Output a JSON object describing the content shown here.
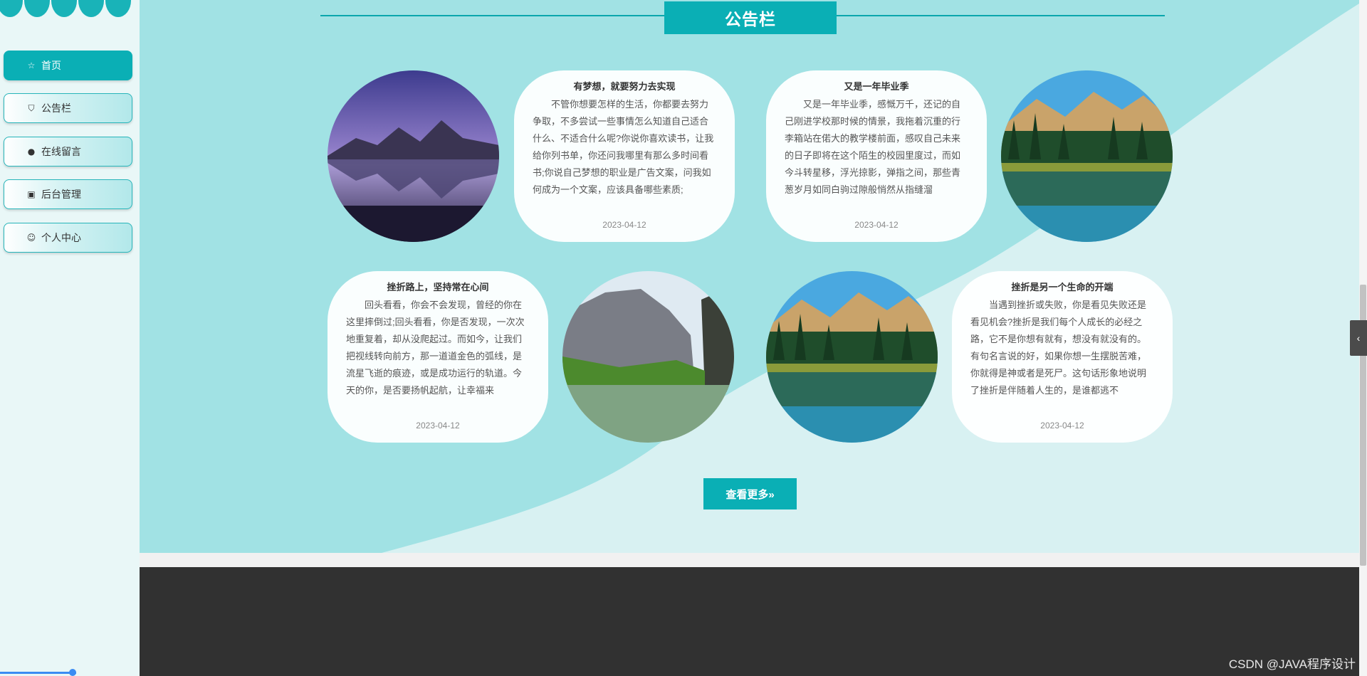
{
  "sidebar": {
    "items": [
      {
        "label": "首页",
        "icon": "star-icon",
        "glyph": "☆"
      },
      {
        "label": "公告栏",
        "icon": "bag-icon",
        "glyph": "⛉"
      },
      {
        "label": "在线留言",
        "icon": "alert-icon",
        "glyph": "●"
      },
      {
        "label": "后台管理",
        "icon": "briefcase-icon",
        "glyph": "▣"
      },
      {
        "label": "个人中心",
        "icon": "user-icon",
        "glyph": "☺"
      }
    ]
  },
  "section": {
    "title": "公告栏"
  },
  "cards": [
    {
      "title": "有梦想，就要努力去实现",
      "body": "不管你想要怎样的生活，你都要去努力争取，不多尝试一些事情怎么知道自己适合什么、不适合什么呢?你说你喜欢读书，让我给你列书单，你还问我哪里有那么多时间看书;你说自己梦想的职业是广告文案，问我如何成为一个文案，应该具备哪些素质;",
      "date": "2023-04-12"
    },
    {
      "title": "又是一年毕业季",
      "body": "又是一年毕业季，感慨万千，还记的自己刚进学校那时候的情景，我拖着沉重的行李箱站在偌大的教学楼前面，感叹自己未来的日子即将在这个陌生的校园里度过，而如今斗转星移，浮光掠影，弹指之间，那些青葱岁月如同白驹过隙般悄然从指缝溜",
      "date": "2023-04-12"
    },
    {
      "title": "挫折路上，坚持常在心间",
      "body": "回头看看，你会不会发现，曾经的你在这里摔倒过;回头看看，你是否发现，一次次地重复着，却从没爬起过。而如今，让我们把视线转向前方，那一道道金色的弧线，是流星飞逝的痕迹，或是成功运行的轨道。今天的你，是否要扬帆起航，让幸福来",
      "date": "2023-04-12"
    },
    {
      "title": "挫折是另一个生命的开端",
      "body": "当遇到挫折或失败，你是看见失败还是看见机会?挫折是我们每个人成长的必经之路，它不是你想有就有，想没有就没有的。有句名言说的好，如果你想一生摆脱苦难，你就得是神或者是死尸。这句话形象地说明了挫折是伴随着人生的，是谁都逃不",
      "date": "2023-04-12"
    }
  ],
  "more_button": "查看更多»",
  "watermark": "CSDN @JAVA程序设计",
  "side_tab": "‹",
  "colors": {
    "accent": "#0aafb5",
    "wave": "#a1e2e4",
    "footer": "#313131"
  }
}
